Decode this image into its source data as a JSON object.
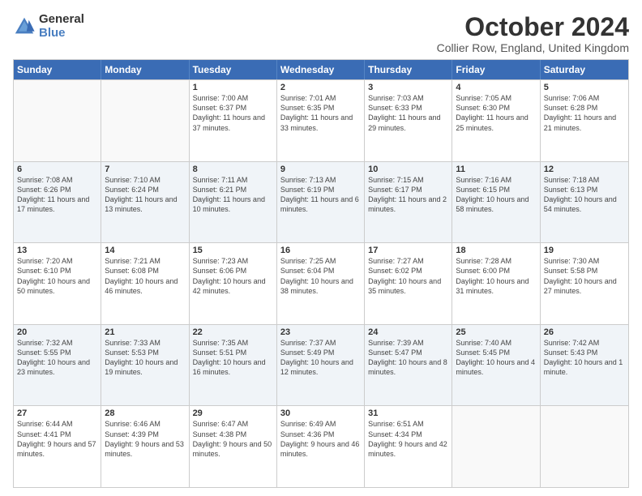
{
  "logo": {
    "general": "General",
    "blue": "Blue"
  },
  "title": "October 2024",
  "location": "Collier Row, England, United Kingdom",
  "weekdays": [
    "Sunday",
    "Monday",
    "Tuesday",
    "Wednesday",
    "Thursday",
    "Friday",
    "Saturday"
  ],
  "weeks": [
    [
      {
        "day": "",
        "sunrise": "",
        "sunset": "",
        "daylight": ""
      },
      {
        "day": "",
        "sunrise": "",
        "sunset": "",
        "daylight": ""
      },
      {
        "day": "1",
        "sunrise": "Sunrise: 7:00 AM",
        "sunset": "Sunset: 6:37 PM",
        "daylight": "Daylight: 11 hours and 37 minutes."
      },
      {
        "day": "2",
        "sunrise": "Sunrise: 7:01 AM",
        "sunset": "Sunset: 6:35 PM",
        "daylight": "Daylight: 11 hours and 33 minutes."
      },
      {
        "day": "3",
        "sunrise": "Sunrise: 7:03 AM",
        "sunset": "Sunset: 6:33 PM",
        "daylight": "Daylight: 11 hours and 29 minutes."
      },
      {
        "day": "4",
        "sunrise": "Sunrise: 7:05 AM",
        "sunset": "Sunset: 6:30 PM",
        "daylight": "Daylight: 11 hours and 25 minutes."
      },
      {
        "day": "5",
        "sunrise": "Sunrise: 7:06 AM",
        "sunset": "Sunset: 6:28 PM",
        "daylight": "Daylight: 11 hours and 21 minutes."
      }
    ],
    [
      {
        "day": "6",
        "sunrise": "Sunrise: 7:08 AM",
        "sunset": "Sunset: 6:26 PM",
        "daylight": "Daylight: 11 hours and 17 minutes."
      },
      {
        "day": "7",
        "sunrise": "Sunrise: 7:10 AM",
        "sunset": "Sunset: 6:24 PM",
        "daylight": "Daylight: 11 hours and 13 minutes."
      },
      {
        "day": "8",
        "sunrise": "Sunrise: 7:11 AM",
        "sunset": "Sunset: 6:21 PM",
        "daylight": "Daylight: 11 hours and 10 minutes."
      },
      {
        "day": "9",
        "sunrise": "Sunrise: 7:13 AM",
        "sunset": "Sunset: 6:19 PM",
        "daylight": "Daylight: 11 hours and 6 minutes."
      },
      {
        "day": "10",
        "sunrise": "Sunrise: 7:15 AM",
        "sunset": "Sunset: 6:17 PM",
        "daylight": "Daylight: 11 hours and 2 minutes."
      },
      {
        "day": "11",
        "sunrise": "Sunrise: 7:16 AM",
        "sunset": "Sunset: 6:15 PM",
        "daylight": "Daylight: 10 hours and 58 minutes."
      },
      {
        "day": "12",
        "sunrise": "Sunrise: 7:18 AM",
        "sunset": "Sunset: 6:13 PM",
        "daylight": "Daylight: 10 hours and 54 minutes."
      }
    ],
    [
      {
        "day": "13",
        "sunrise": "Sunrise: 7:20 AM",
        "sunset": "Sunset: 6:10 PM",
        "daylight": "Daylight: 10 hours and 50 minutes."
      },
      {
        "day": "14",
        "sunrise": "Sunrise: 7:21 AM",
        "sunset": "Sunset: 6:08 PM",
        "daylight": "Daylight: 10 hours and 46 minutes."
      },
      {
        "day": "15",
        "sunrise": "Sunrise: 7:23 AM",
        "sunset": "Sunset: 6:06 PM",
        "daylight": "Daylight: 10 hours and 42 minutes."
      },
      {
        "day": "16",
        "sunrise": "Sunrise: 7:25 AM",
        "sunset": "Sunset: 6:04 PM",
        "daylight": "Daylight: 10 hours and 38 minutes."
      },
      {
        "day": "17",
        "sunrise": "Sunrise: 7:27 AM",
        "sunset": "Sunset: 6:02 PM",
        "daylight": "Daylight: 10 hours and 35 minutes."
      },
      {
        "day": "18",
        "sunrise": "Sunrise: 7:28 AM",
        "sunset": "Sunset: 6:00 PM",
        "daylight": "Daylight: 10 hours and 31 minutes."
      },
      {
        "day": "19",
        "sunrise": "Sunrise: 7:30 AM",
        "sunset": "Sunset: 5:58 PM",
        "daylight": "Daylight: 10 hours and 27 minutes."
      }
    ],
    [
      {
        "day": "20",
        "sunrise": "Sunrise: 7:32 AM",
        "sunset": "Sunset: 5:55 PM",
        "daylight": "Daylight: 10 hours and 23 minutes."
      },
      {
        "day": "21",
        "sunrise": "Sunrise: 7:33 AM",
        "sunset": "Sunset: 5:53 PM",
        "daylight": "Daylight: 10 hours and 19 minutes."
      },
      {
        "day": "22",
        "sunrise": "Sunrise: 7:35 AM",
        "sunset": "Sunset: 5:51 PM",
        "daylight": "Daylight: 10 hours and 16 minutes."
      },
      {
        "day": "23",
        "sunrise": "Sunrise: 7:37 AM",
        "sunset": "Sunset: 5:49 PM",
        "daylight": "Daylight: 10 hours and 12 minutes."
      },
      {
        "day": "24",
        "sunrise": "Sunrise: 7:39 AM",
        "sunset": "Sunset: 5:47 PM",
        "daylight": "Daylight: 10 hours and 8 minutes."
      },
      {
        "day": "25",
        "sunrise": "Sunrise: 7:40 AM",
        "sunset": "Sunset: 5:45 PM",
        "daylight": "Daylight: 10 hours and 4 minutes."
      },
      {
        "day": "26",
        "sunrise": "Sunrise: 7:42 AM",
        "sunset": "Sunset: 5:43 PM",
        "daylight": "Daylight: 10 hours and 1 minute."
      }
    ],
    [
      {
        "day": "27",
        "sunrise": "Sunrise: 6:44 AM",
        "sunset": "Sunset: 4:41 PM",
        "daylight": "Daylight: 9 hours and 57 minutes."
      },
      {
        "day": "28",
        "sunrise": "Sunrise: 6:46 AM",
        "sunset": "Sunset: 4:39 PM",
        "daylight": "Daylight: 9 hours and 53 minutes."
      },
      {
        "day": "29",
        "sunrise": "Sunrise: 6:47 AM",
        "sunset": "Sunset: 4:38 PM",
        "daylight": "Daylight: 9 hours and 50 minutes."
      },
      {
        "day": "30",
        "sunrise": "Sunrise: 6:49 AM",
        "sunset": "Sunset: 4:36 PM",
        "daylight": "Daylight: 9 hours and 46 minutes."
      },
      {
        "day": "31",
        "sunrise": "Sunrise: 6:51 AM",
        "sunset": "Sunset: 4:34 PM",
        "daylight": "Daylight: 9 hours and 42 minutes."
      },
      {
        "day": "",
        "sunrise": "",
        "sunset": "",
        "daylight": ""
      },
      {
        "day": "",
        "sunrise": "",
        "sunset": "",
        "daylight": ""
      }
    ]
  ]
}
